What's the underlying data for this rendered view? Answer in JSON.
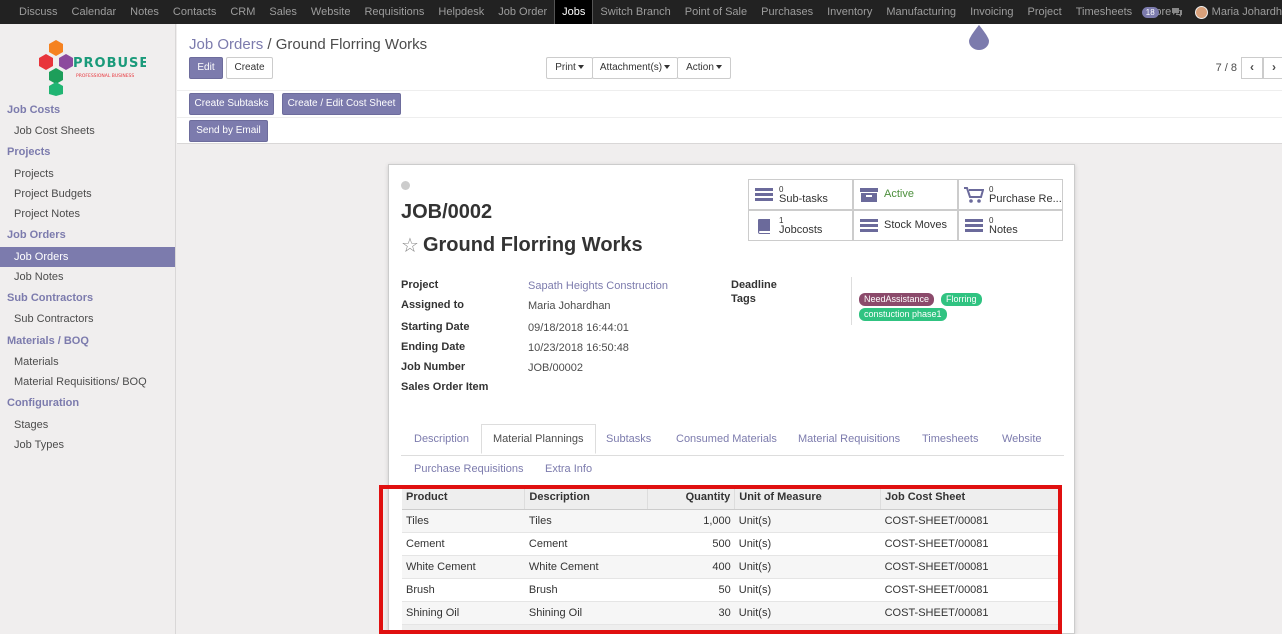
{
  "topnav": {
    "items": [
      "Discuss",
      "Calendar",
      "Notes",
      "Contacts",
      "CRM",
      "Sales",
      "Website",
      "Requisitions",
      "Helpdesk",
      "Job Order",
      "Jobs",
      "Switch Branch",
      "Point of Sale",
      "Purchases",
      "Inventory",
      "Manufacturing",
      "Invoicing",
      "Project",
      "Timesheets",
      "More"
    ],
    "active": "Jobs",
    "notification_count": "18",
    "user_name": "Maria Johardh"
  },
  "logo": {
    "text": "PROBUSE",
    "subtext": "PROFESSIONAL BUSINESS"
  },
  "sidebar": {
    "sections": [
      {
        "title": "Job Costs",
        "items": [
          "Job Cost Sheets"
        ]
      },
      {
        "title": "Projects",
        "items": [
          "Projects",
          "Project Budgets",
          "Project Notes"
        ]
      },
      {
        "title": "Job Orders",
        "items": [
          "Job Orders",
          "Job Notes"
        ]
      },
      {
        "title": "Sub Contractors",
        "items": [
          "Sub Contractors"
        ]
      },
      {
        "title": "Materials / BOQ",
        "items": [
          "Materials",
          "Material Requisitions/ BOQ"
        ]
      },
      {
        "title": "Configuration",
        "items": [
          "Stages",
          "Job Types"
        ]
      }
    ],
    "active_item": "Job Orders"
  },
  "breadcrumb": {
    "parent": "Job Orders",
    "separator": "/",
    "current": "Ground Florring Works"
  },
  "buttons": {
    "edit": "Edit",
    "create": "Create",
    "print": "Print",
    "attachments": "Attachment(s)",
    "action": "Action",
    "create_subtasks": "Create Subtasks",
    "cost_sheet": "Create / Edit Cost Sheet",
    "send_email": "Send by Email"
  },
  "pager": {
    "value": "7 / 8",
    "prev": "‹",
    "next": "›"
  },
  "record": {
    "number": "JOB/0002",
    "title": "Ground Florring Works",
    "stats": {
      "subtasks": {
        "count": "0",
        "label": "Sub-tasks"
      },
      "active": {
        "label": "Active"
      },
      "purchase": {
        "count": "0",
        "label": "Purchase Re..."
      },
      "jobcosts": {
        "count": "1",
        "label": "Jobcosts"
      },
      "stock_moves": {
        "label": "Stock Moves"
      },
      "notes": {
        "count": "0",
        "label": "Notes"
      }
    },
    "fields": {
      "project_label": "Project",
      "project": "Sapath Heights Construction",
      "assigned_label": "Assigned to",
      "assigned": "Maria Johardhan",
      "start_label": "Starting Date",
      "start": "09/18/2018 16:44:01",
      "end_label": "Ending Date",
      "end": "10/23/2018 16:50:48",
      "jobnum_label": "Job Number",
      "jobnum": "JOB/00002",
      "sales_label": "Sales Order Item",
      "deadline_label": "Deadline",
      "tags_label": "Tags"
    },
    "tags": [
      {
        "label": "NeedAssistance",
        "color": "#8b4a6b"
      },
      {
        "label": "Florring",
        "color": "#30c381"
      },
      {
        "label": "constuction phase1",
        "color": "#30c381"
      }
    ]
  },
  "tabs": {
    "row1": [
      "Description",
      "Material Plannings",
      "Subtasks",
      "Consumed Materials",
      "Material Requisitions",
      "Timesheets",
      "Website"
    ],
    "row2": [
      "Purchase Requisitions",
      "Extra Info"
    ],
    "active": "Material Plannings"
  },
  "table": {
    "headers": [
      "Product",
      "Description",
      "Quantity",
      "Unit of Measure",
      "Job Cost Sheet"
    ],
    "rows": [
      [
        "Tiles",
        "Tiles",
        "1,000",
        "Unit(s)",
        "COST-SHEET/00081"
      ],
      [
        "Cement",
        "Cement",
        "500",
        "Unit(s)",
        "COST-SHEET/00081"
      ],
      [
        "White Cement",
        "White Cement",
        "400",
        "Unit(s)",
        "COST-SHEET/00081"
      ],
      [
        "Brush",
        "Brush",
        "50",
        "Unit(s)",
        "COST-SHEET/00081"
      ],
      [
        "Shining Oil",
        "Shining Oil",
        "30",
        "Unit(s)",
        "COST-SHEET/00081"
      ]
    ]
  },
  "colors": {
    "brand": "#7c7bad",
    "highlight": "#e01010",
    "active_status": "#4c8f3c"
  }
}
